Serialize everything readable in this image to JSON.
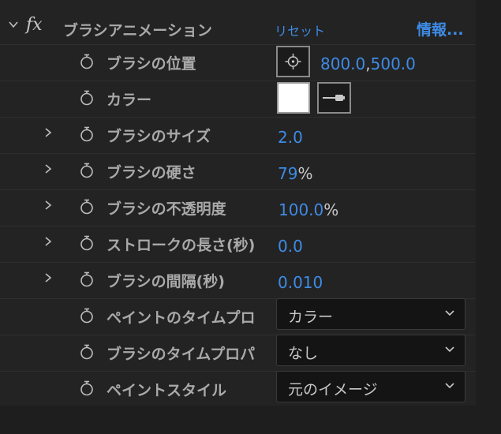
{
  "effect": {
    "name": "ブラシアニメーション",
    "reset_label": "リセット",
    "info_label": "情報..."
  },
  "properties": [
    {
      "label": "ブラシの位置",
      "value": "800.0,500.0",
      "value_x": "800.0",
      "value_sep": ",",
      "value_y": "500.0",
      "icon": "crosshair-icon"
    },
    {
      "label": "カラー",
      "color": "#ffffff",
      "icon": "eyedropper-icon"
    },
    {
      "label": "ブラシのサイズ",
      "value": "2.0"
    },
    {
      "label": "ブラシの硬さ",
      "value": "79",
      "unit": "%"
    },
    {
      "label": "ブラシの不透明度",
      "value": "100.0",
      "unit": "%"
    },
    {
      "label": "ストロークの長さ(秒)",
      "value": "0.0"
    },
    {
      "label": "ブラシの間隔(秒)",
      "value": "0.010"
    },
    {
      "label": "ペイントのタイムプロ",
      "dropdown": "カラー"
    },
    {
      "label": "ブラシのタイムプロパ",
      "dropdown": "なし"
    },
    {
      "label": "ペイントスタイル",
      "dropdown": "元のイメージ"
    }
  ],
  "icons": {
    "expand": "chevron-down-icon",
    "collapse": "chevron-right-icon",
    "stopwatch": "stopwatch-icon",
    "fx": "fx-icon"
  },
  "colors": {
    "accent": "#3e8be6",
    "panel_bg": "#232323",
    "label": "#a9a9a9"
  }
}
